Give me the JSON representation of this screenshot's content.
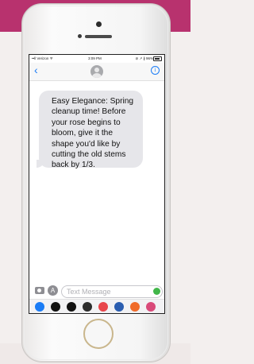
{
  "status_bar": {
    "carrier": "••ll Verizon ᯤ",
    "time": "3:09 PM",
    "right_icons": "⊘ ↗ ∦ 96%"
  },
  "nav": {
    "back_glyph": "‹",
    "info_glyph": "i"
  },
  "message": {
    "text": "Easy Elegance: Spring\ncleanup time! Before\nyour rose begins to\nbloom, give it the\nshape you'd like by\ncutting the old stems\nback by 1/3."
  },
  "composer": {
    "placeholder": "Text Message",
    "appstore_glyph": "A"
  },
  "app_drawer": [
    {
      "name": "app-store-drawer-icon",
      "color": "#1a7cf6"
    },
    {
      "name": "apple-pay-icon",
      "color": "#111111"
    },
    {
      "name": "music-icon",
      "color": "#111111"
    },
    {
      "name": "hearts-icon",
      "color": "#2d2d2d"
    },
    {
      "name": "search-images-icon",
      "color": "#e8454b"
    },
    {
      "name": "paypal-icon",
      "color": "#2a5db0"
    },
    {
      "name": "stickers-icon",
      "color": "#f06b2a"
    },
    {
      "name": "more-apps-icon",
      "color": "#d94a7a"
    }
  ],
  "colors": {
    "banner": "#b8326e",
    "link": "#1a7cf6",
    "bubble": "#e6e6ea"
  }
}
